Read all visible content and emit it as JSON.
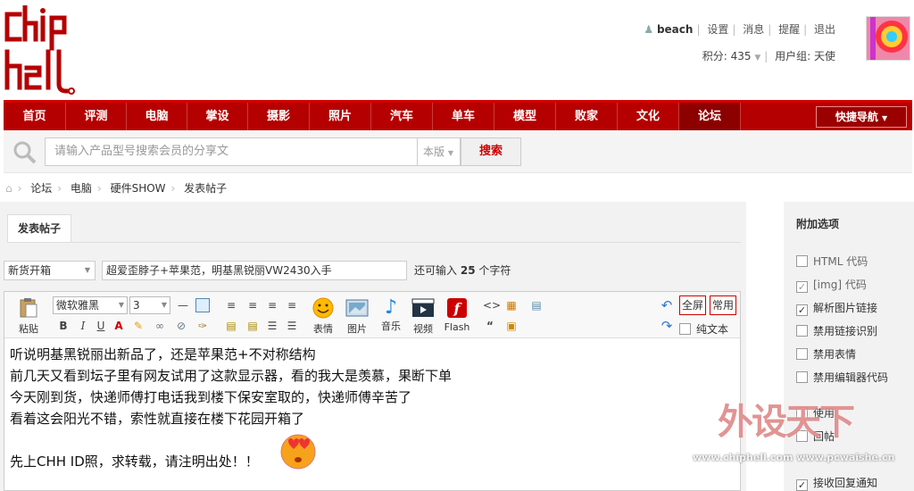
{
  "user": {
    "name": "beach",
    "links": [
      "设置",
      "消息",
      "提醒",
      "退出"
    ],
    "points": "积分: 435",
    "group": "用户组: 天使"
  },
  "nav": {
    "items": [
      "首页",
      "评测",
      "电脑",
      "掌设",
      "摄影",
      "照片",
      "汽车",
      "单车",
      "模型",
      "败家",
      "文化",
      "论坛"
    ],
    "quick": "快捷导航"
  },
  "search": {
    "placeholder": "请输入产品型号搜索会员的分享文",
    "scope": "本版",
    "button": "搜索"
  },
  "breadcrumb": [
    "论坛",
    "电脑",
    "硬件SHOW",
    "发表帖子"
  ],
  "tab": "发表帖子",
  "post": {
    "type": "新货开箱",
    "title": "超爱歪脖子+苹果范，明基黑锐丽VW2430入手",
    "remaining_prefix": "还可输入",
    "remaining_num": "25",
    "remaining_suffix": "个字符"
  },
  "toolbar": {
    "paste": "粘贴",
    "font": "微软雅黑",
    "size": "3",
    "emoji": "表情",
    "image": "图片",
    "music": "音乐",
    "video": "视频",
    "flash": "Flash",
    "fullscreen": "全屏",
    "common": "常用",
    "plaintext": "纯文本"
  },
  "content": [
    "听说明基黑锐丽出新品了，还是苹果范+不对称结构",
    "前几天又看到坛子里有网友试用了这款显示器，看的我大是羡慕，果断下单",
    "今天刚到货，快递师傅打电话我到楼下保安室取的，快递师傅辛苦了",
    "看着这会阳光不错，索性就直接在楼下花园开箱了",
    "",
    "先上CHH ID照，求转载，请注明出处！！"
  ],
  "sidebar": {
    "title": "附加选项",
    "options": [
      {
        "label": "HTML 代码",
        "checked": false
      },
      {
        "label": "[img] 代码",
        "checked": true
      },
      {
        "label": "解析图片链接",
        "checked": true
      },
      {
        "label": "禁用链接识别",
        "checked": false
      },
      {
        "label": "禁用表情",
        "checked": false
      },
      {
        "label": "禁用编辑器代码",
        "checked": false
      },
      {
        "label": "使用",
        "checked": false
      },
      {
        "label": "回帖",
        "checked": false
      },
      {
        "label": "",
        "checked": false
      },
      {
        "label": "接收回复通知",
        "checked": true
      }
    ]
  },
  "watermark": {
    "line1": "外设天下",
    "line2": "www.chiphell.com  www.pcwaishe.cn"
  },
  "colors": {
    "brand": "#b50000",
    "nav_active": "#8d0000"
  }
}
